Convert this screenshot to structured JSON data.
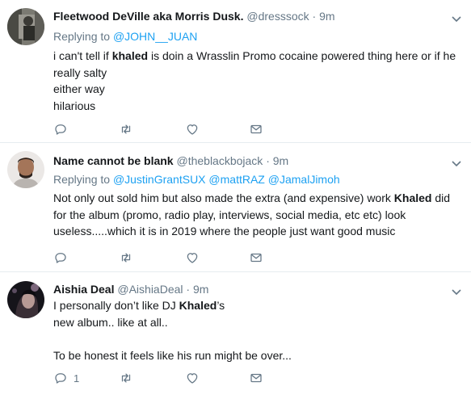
{
  "tweets": [
    {
      "name": "Fleetwood DeVille aka Morris Dusk.",
      "handle": "@dresssock",
      "sep": "·",
      "time": "9m",
      "replying_label": "Replying to",
      "mentions": [
        "@JOHN__JUAN"
      ],
      "lines": [
        [
          {
            "t": "i can't tell if "
          },
          {
            "t": "khaled",
            "b": true
          },
          {
            "t": " is doin a Wrasslin Promo cocaine powered thing here or if he"
          }
        ],
        [
          {
            "t": "really salty"
          }
        ],
        [
          {
            "t": "either way"
          }
        ],
        [
          {
            "t": "hilarious"
          }
        ]
      ],
      "reply_count": "",
      "avatar_colors": [
        "#6d6c66",
        "#2f302c"
      ]
    },
    {
      "name": "Name cannot be blank",
      "handle": "@theblackbojack",
      "sep": "·",
      "time": "9m",
      "replying_label": "Replying to",
      "mentions": [
        "@JustinGrantSUX",
        "@mattRAZ",
        "@JamalJimoh"
      ],
      "lines": [
        [
          {
            "t": "Not only out sold him but also made the extra (and expensive) work "
          },
          {
            "t": "Khaled",
            "b": true
          },
          {
            "t": " did"
          }
        ],
        [
          {
            "t": "for the album (promo, radio play, interviews, social media, etc etc) look"
          }
        ],
        [
          {
            "t": "useless.....which it is in 2019 where the people just want good music"
          }
        ]
      ],
      "reply_count": "",
      "avatar_colors": [
        "#e9e6e4",
        "#a0735a"
      ]
    },
    {
      "name": "Aishia Deal",
      "handle": "@AishiaDeal",
      "sep": "·",
      "time": "9m",
      "replying_label": "",
      "mentions": [],
      "lines": [
        [
          {
            "t": "I personally don’t like DJ "
          },
          {
            "t": "Khaled",
            "b": true
          },
          {
            "t": "’s"
          }
        ],
        [
          {
            "t": "new album.. like at all.."
          }
        ],
        [
          {
            "t": ""
          }
        ],
        [
          {
            "t": "To be honest it feels like his run might be over..."
          }
        ]
      ],
      "reply_count": "1",
      "avatar_colors": [
        "#1b1b22",
        "#7a6a78"
      ]
    }
  ],
  "icons": {
    "reply": "reply-icon",
    "retweet": "retweet-icon",
    "like": "heart-icon",
    "dm": "envelope-icon",
    "caret": "chevron-down-icon"
  },
  "colors": {
    "link": "#1da1f2",
    "muted": "#657786",
    "text": "#14171a",
    "divider": "#e6ecf0"
  }
}
